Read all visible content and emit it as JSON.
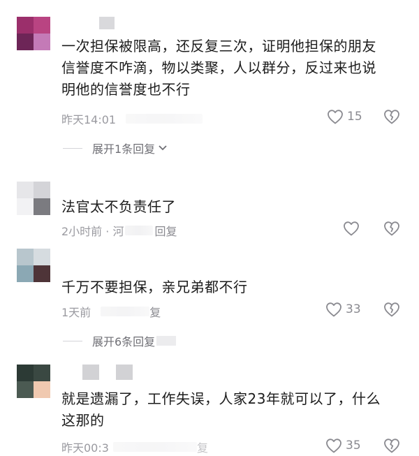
{
  "comments": [
    {
      "text_lines": [
        "一次担保被限高，还反复三次，证明他担保的朋友",
        "信誉度不咋滴，物以类聚，人以群分，反过来也说",
        "明他的信誉度也不行"
      ],
      "time": "昨天14:01",
      "like_count": "15",
      "expand_label": "展开1条回复",
      "avatar_colors": [
        "#9b2f6b",
        "#b94482",
        "#6d2557",
        "#c47ab7"
      ]
    },
    {
      "text_lines": [
        "法官太不负责任了"
      ],
      "time": "2小时前 · 河",
      "reply_label": "回复",
      "avatar_colors": [
        "#e6e6e9",
        "#d4d4d8",
        "#f2f2f4",
        "#7b7b80"
      ]
    },
    {
      "text_lines": [
        "千万不要担保，亲兄弟都不行"
      ],
      "time": "1天前",
      "reply_label": "复",
      "like_count": "33",
      "expand_label": "展开6条回复",
      "avatar_colors": [
        "#b8c6cd",
        "#d6dce0",
        "#8ba8b4",
        "#4e3438"
      ]
    },
    {
      "text_lines": [
        "就是遗漏了，工作失误，人家23年就可以了，什么",
        "这那的"
      ],
      "time": "昨天00:3",
      "reply_label": "复",
      "like_count": "35",
      "avatar_colors": [
        "#2c3a35",
        "#3a4842",
        "#4b5a52",
        "#f0c9b0"
      ]
    }
  ],
  "icons": {
    "like": "heart-outline-icon",
    "dislike": "broken-heart-icon",
    "expand": "chevron-down-icon"
  }
}
